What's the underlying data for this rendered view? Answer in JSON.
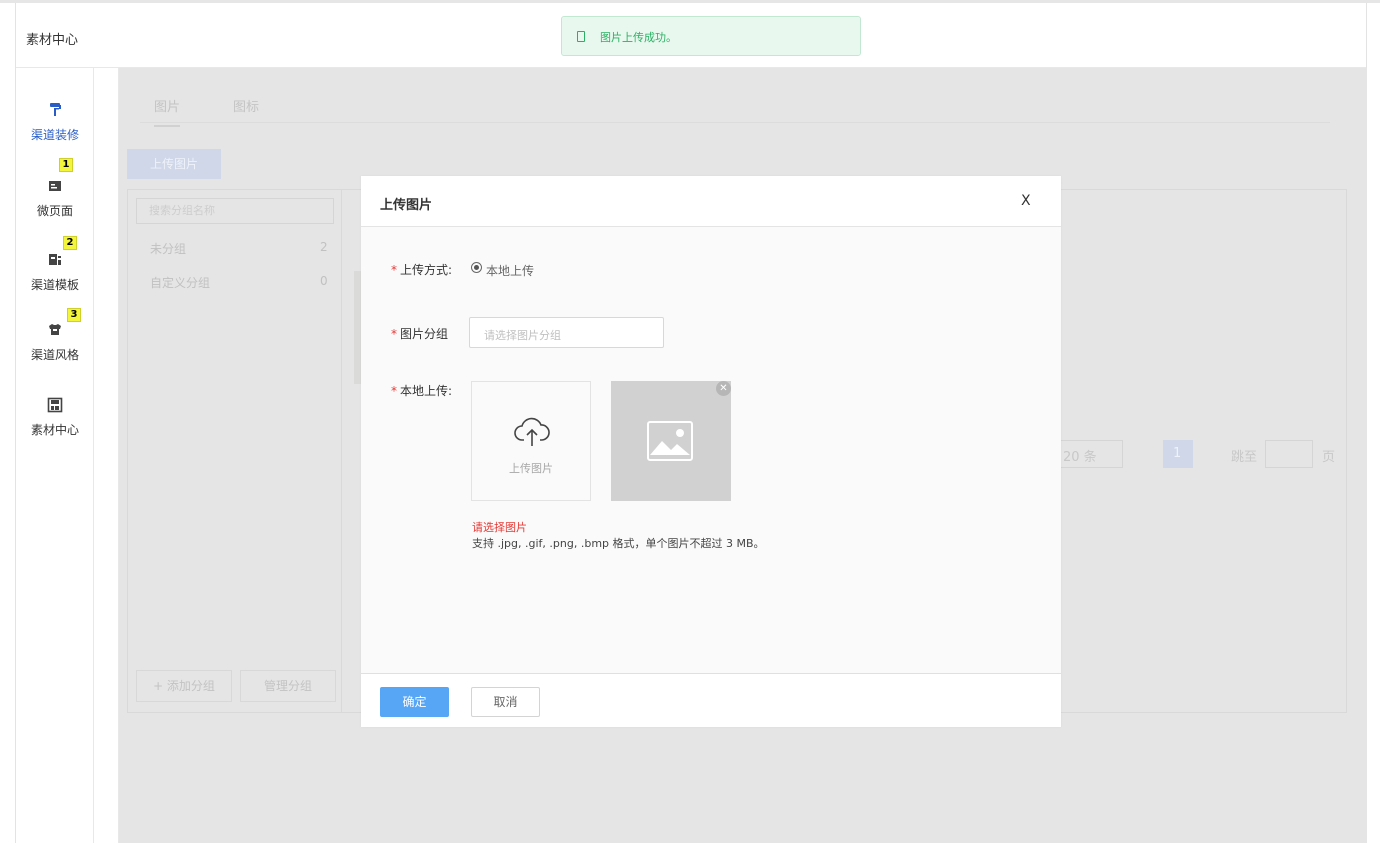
{
  "header": {
    "title": "素材中心"
  },
  "toast": {
    "message": "图片上传成功。"
  },
  "sidebar": {
    "items": [
      {
        "label": "渠道装修",
        "active": true
      },
      {
        "label": "微页面",
        "badge": "1"
      },
      {
        "label": "渠道模板",
        "badge": "2"
      },
      {
        "label": "渠道风格",
        "badge": "3"
      },
      {
        "label": "素材中心"
      }
    ]
  },
  "background": {
    "tabs": [
      "图片",
      "图标"
    ],
    "upload_button": "上传图片",
    "search_placeholder": "搜索分组名称",
    "groups": [
      {
        "name": "未分组",
        "count": "2"
      },
      {
        "name": "自定义分组",
        "count": "0"
      }
    ],
    "add_group": "+ 添加分组",
    "manage_group": "管理分组",
    "pager": {
      "page_size": "20 条",
      "current_page": "1",
      "jump_label": "跳至",
      "page_unit": "页"
    }
  },
  "modal": {
    "title": "上传图片",
    "close": "X",
    "fields": {
      "method_label": "上传方式:",
      "method_value": "本地上传",
      "group_label": "图片分组",
      "group_placeholder": "请选择图片分组",
      "local_label": "本地上传:"
    },
    "upload_box_label": "上传图片",
    "error_text": "请选择图片",
    "hint_text": "支持 .jpg, .gif, .png, .bmp 格式，单个图片不超过 3 MB。",
    "confirm": "确定",
    "cancel": "取消"
  },
  "colors": {
    "accent": "#57a5f5",
    "success": "#2bb063",
    "error": "#e53935",
    "badge": "#f3f53c"
  }
}
